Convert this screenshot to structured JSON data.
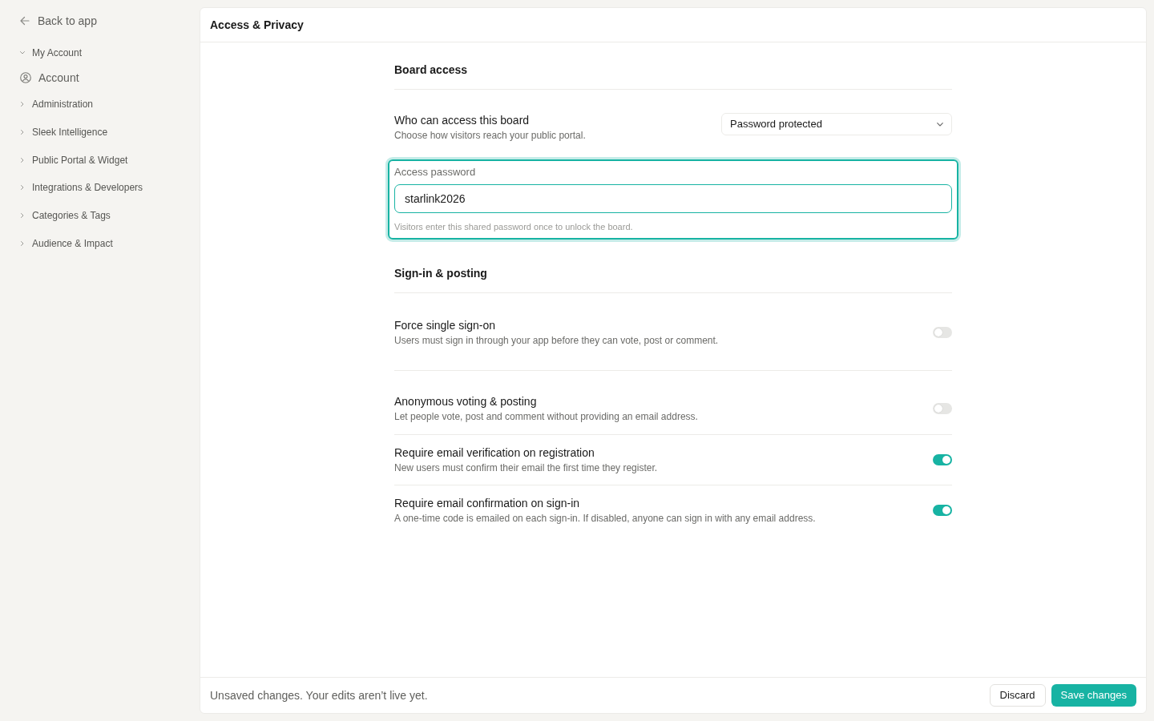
{
  "sidebar": {
    "back_link": "Back to app",
    "groups": [
      {
        "label": "My Account",
        "expanded": true,
        "children": [
          {
            "label": "Account"
          }
        ]
      },
      {
        "label": "Administration",
        "expanded": false
      },
      {
        "label": "Sleek Intelligence",
        "expanded": false
      },
      {
        "label": "Public Portal & Widget",
        "expanded": false
      },
      {
        "label": "Integrations & Developers",
        "expanded": false
      },
      {
        "label": "Categories & Tags",
        "expanded": false
      },
      {
        "label": "Audience & Impact",
        "expanded": false
      }
    ]
  },
  "page": {
    "title": "Access & Privacy"
  },
  "sections": [
    {
      "heading": "Board access",
      "rows": [
        {
          "kind": "select",
          "title": "Who can access this board",
          "description": "Choose how visitors reach your public portal.",
          "value": "Password protected"
        },
        {
          "kind": "password",
          "label": "Access password",
          "value": "starlink2026",
          "hint": "Visitors enter this shared password once to unlock the board.",
          "highlighted": true
        }
      ]
    },
    {
      "heading": "Sign-in & posting",
      "rows": [
        {
          "kind": "toggle",
          "title": "Force single sign-on",
          "description": "Users must sign in through your app before they can vote, post or comment.",
          "on": false
        },
        {
          "kind": "toggle",
          "title": "Anonymous voting & posting",
          "description": "Let people vote, post and comment without providing an email address.",
          "on": false
        },
        {
          "kind": "toggle",
          "title": "Require email verification on registration",
          "description": "New users must confirm their email the first time they register.",
          "on": true
        },
        {
          "kind": "toggle",
          "title": "Require email confirmation on sign-in",
          "description": "A one-time code is emailed on each sign-in. If disabled, anyone can sign in with any email address.",
          "on": true
        }
      ]
    }
  ],
  "footer": {
    "message": "Unsaved changes. Your edits aren’t live yet.",
    "buttons": [
      {
        "label": "Discard",
        "kind": "secondary"
      },
      {
        "label": "Save changes",
        "kind": "primary"
      }
    ]
  }
}
